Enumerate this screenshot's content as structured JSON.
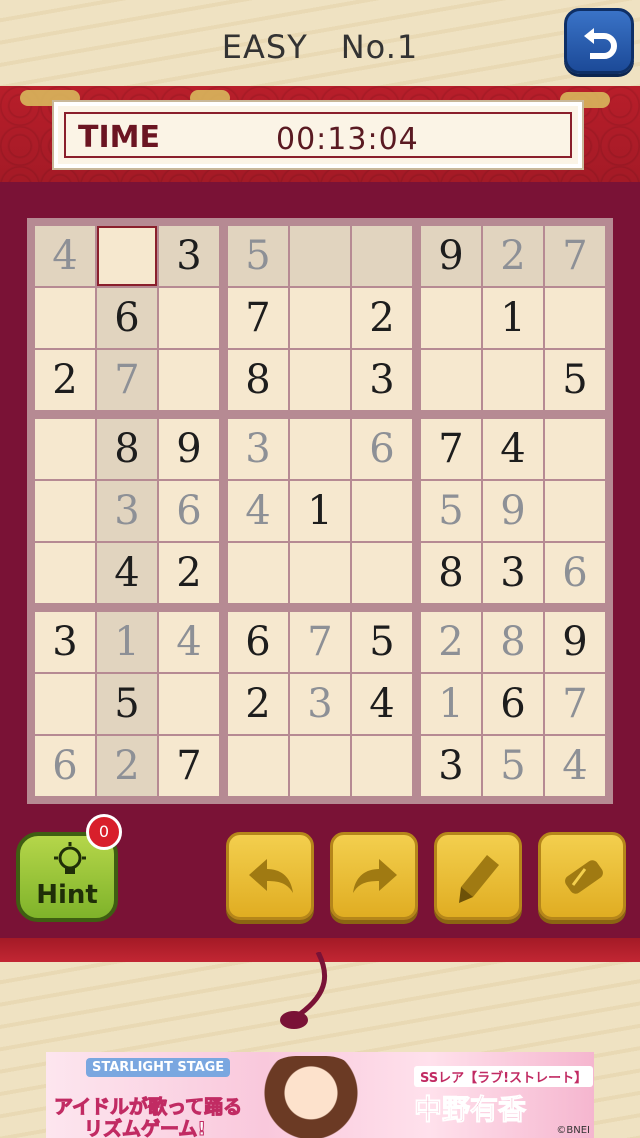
{
  "header": {
    "title": "EASY　No.1"
  },
  "timer": {
    "label": "TIME",
    "value": "00:13:04"
  },
  "board": {
    "selected": [
      0,
      1
    ],
    "grid": [
      [
        "4",
        "",
        "3",
        "5",
        "",
        "",
        "9",
        "2",
        "7"
      ],
      [
        "",
        "6",
        "",
        "7",
        "",
        "2",
        "",
        "1",
        ""
      ],
      [
        "2",
        "7",
        "",
        "8",
        "",
        "3",
        "",
        "",
        "5"
      ],
      [
        "",
        "8",
        "9",
        "3",
        "",
        "6",
        "7",
        "4",
        ""
      ],
      [
        "",
        "3",
        "6",
        "4",
        "1",
        "",
        "5",
        "9",
        ""
      ],
      [
        "",
        "4",
        "2",
        "",
        "",
        "",
        "8",
        "3",
        "6"
      ],
      [
        "3",
        "1",
        "4",
        "6",
        "7",
        "5",
        "2",
        "8",
        "9"
      ],
      [
        "",
        "5",
        "",
        "2",
        "3",
        "4",
        "1",
        "6",
        "7"
      ],
      [
        "6",
        "2",
        "7",
        "",
        "",
        "",
        "3",
        "5",
        "4"
      ]
    ],
    "grey_digits": [
      [
        0,
        0
      ],
      [
        0,
        3
      ],
      [
        0,
        7
      ],
      [
        0,
        8
      ],
      [
        2,
        1
      ],
      [
        3,
        3
      ],
      [
        3,
        5
      ],
      [
        4,
        1
      ],
      [
        4,
        2
      ],
      [
        4,
        3
      ],
      [
        4,
        6
      ],
      [
        4,
        7
      ],
      [
        5,
        8
      ],
      [
        6,
        1
      ],
      [
        6,
        2
      ],
      [
        6,
        4
      ],
      [
        6,
        6
      ],
      [
        6,
        7
      ],
      [
        7,
        4
      ],
      [
        7,
        6
      ],
      [
        7,
        8
      ],
      [
        8,
        0
      ],
      [
        8,
        1
      ],
      [
        8,
        7
      ],
      [
        8,
        8
      ]
    ]
  },
  "controls": {
    "hint_label": "Hint",
    "hint_count": "0",
    "buttons": [
      "undo-arrow-icon",
      "redo-arrow-icon",
      "pencil-icon",
      "eraser-icon"
    ]
  },
  "banner": {
    "logo": "STARLIGHT STAGE",
    "line1": "アイドルが歌って踊る",
    "line2": "リズムゲーム!",
    "rank": "SSレア【ラブ!ストレート】",
    "name": "中野有香",
    "copyright": "©BNEI"
  },
  "colors": {
    "board_frame": "#7a1236",
    "given_digit": "#1d1d1d",
    "entered_digit": "#8d9096",
    "hint_green": "#8fbf2e",
    "control_yellow": "#eec03a",
    "back_blue": "#2a5fb5"
  }
}
